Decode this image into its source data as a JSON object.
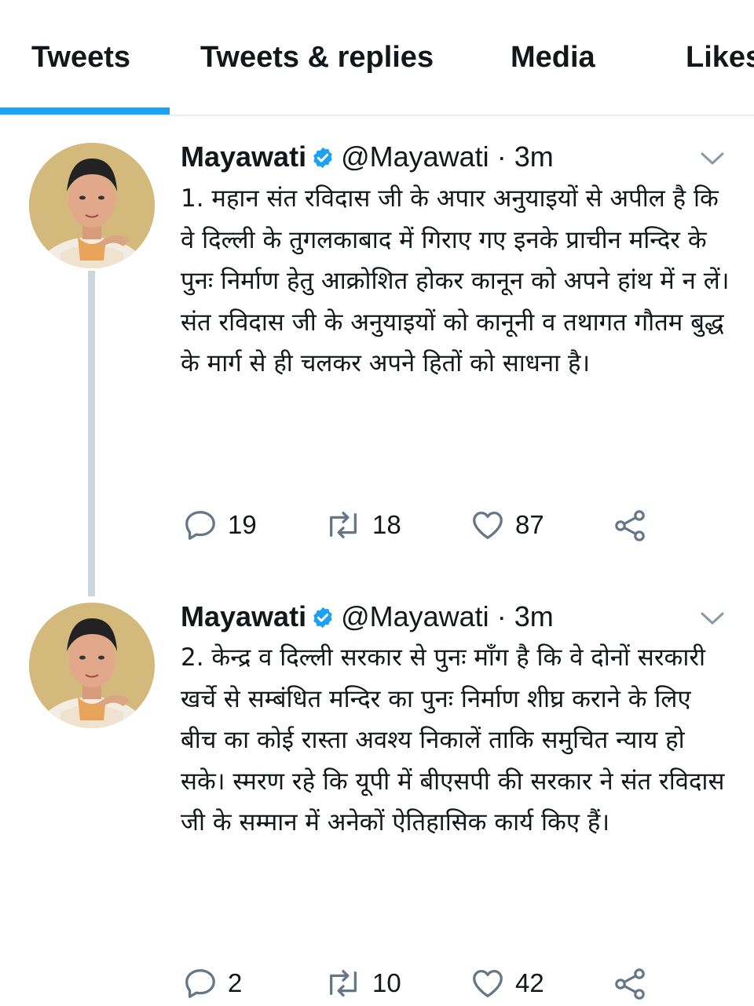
{
  "tabs": [
    {
      "label": "Tweets",
      "active": true
    },
    {
      "label": "Tweets & replies",
      "active": false
    },
    {
      "label": "Media",
      "active": false
    },
    {
      "label": "Likes",
      "active": false
    }
  ],
  "colors": {
    "accent": "#1da1f2",
    "thread_line": "#ccd6dd",
    "icon": "#657786"
  },
  "tweets": [
    {
      "name": "Mayawati",
      "handle": "@Mayawati",
      "dot": "·",
      "time": "3m",
      "text": "1. महान संत रविदास जी के अपार अनुयाइयों से अपील है कि वे दिल्ली के तुगलकाबाद में गिराए गए इनके प्राचीन मन्दिर के पुनः निर्माण हेतु आक्रोशित होकर कानून को अपने हांथ में न लें। संत रविदास जी के अनुयाइयों को कानूनी व तथागत गौतम बुद्ध के मार्ग से ही चलकर अपने हितों को साधना है।",
      "replies": "19",
      "retweets": "18",
      "likes": "87"
    },
    {
      "name": "Mayawati",
      "handle": "@Mayawati",
      "dot": "·",
      "time": "3m",
      "text": "2. केन्द्र व दिल्ली सरकार से पुनः माँग है कि वे दोनों सरकारी खर्चे से सम्बंधित मन्दिर का पुनः निर्माण शीघ्र कराने के लिए बीच का कोई रास्ता अवश्य निकालें ताकि समुचित न्याय हो सके। स्मरण रहे कि यूपी में बीएसपी की सरकार ने संत रविदास जी के सम्मान में अनेकों ऐतिहासिक कार्य किए हैं।",
      "replies": "2",
      "retweets": "10",
      "likes": "42"
    }
  ]
}
